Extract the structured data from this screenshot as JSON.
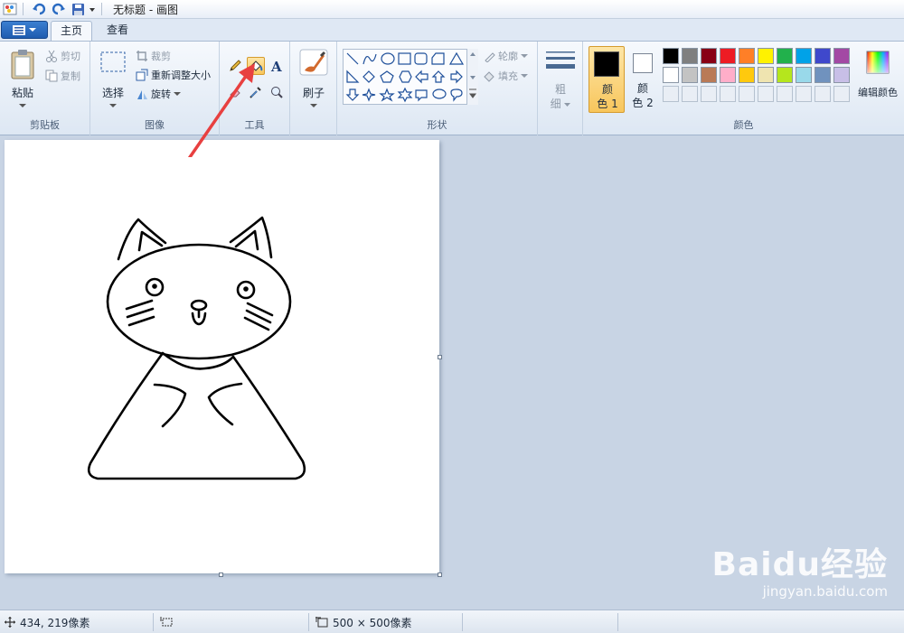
{
  "window": {
    "title": "无标题 - 画图"
  },
  "tabs": [
    {
      "label": "主页",
      "active": true
    },
    {
      "label": "查看",
      "active": false
    }
  ],
  "clipboard": {
    "paste": "粘贴",
    "cut": "剪切",
    "copy": "复制",
    "label": "剪贴板"
  },
  "image": {
    "select": "选择",
    "crop": "裁剪",
    "resize": "重新调整大小",
    "rotate": "旋转",
    "label": "图像"
  },
  "tools": {
    "label": "工具",
    "selected": "fill-bucket"
  },
  "brushes": {
    "label": "刷子"
  },
  "shapes": {
    "outline": "轮廓",
    "fill": "填充",
    "label": "形状"
  },
  "size": {
    "label_line1": "粗",
    "label_line2": "细"
  },
  "colors": {
    "color1_line1": "颜",
    "color1_line2": "色 1",
    "color2_line1": "颜",
    "color2_line2": "色 2",
    "edit": "编辑颜色",
    "label": "颜色",
    "color1": "#000000",
    "color2": "#ffffff",
    "palette_row1": [
      "#000000",
      "#7f7f7f",
      "#880015",
      "#ed1c24",
      "#ff7f27",
      "#fff200",
      "#22b14c",
      "#00a2e8",
      "#3f48cc",
      "#a349a4"
    ],
    "palette_row2": [
      "#ffffff",
      "#c3c3c3",
      "#b97a57",
      "#ffaec9",
      "#ffc90e",
      "#efe4b0",
      "#b5e61d",
      "#99d9ea",
      "#7092be",
      "#c8bfe7"
    ]
  },
  "status": {
    "cursor": "434, 219像素",
    "selection": "",
    "canvas_size": "500 × 500像素"
  },
  "watermark": {
    "brand": "Baidu经验",
    "url": "jingyan.baidu.com"
  }
}
